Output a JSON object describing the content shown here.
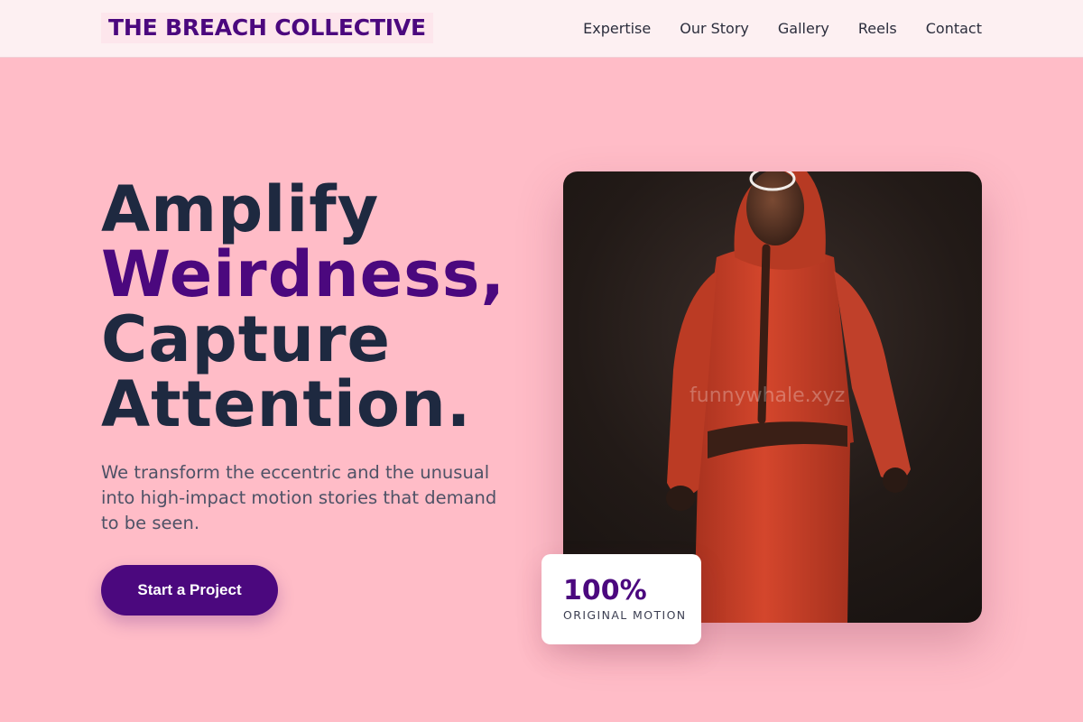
{
  "header": {
    "logo": "THE BREACH COLLECTIVE",
    "nav": [
      "Expertise",
      "Our Story",
      "Gallery",
      "Reels",
      "Contact"
    ]
  },
  "hero": {
    "title_line1": "Amplify",
    "title_accent": "Weirdness,",
    "title_line3": "Capture",
    "title_line4": "Attention.",
    "subtitle": "We transform the eccentric and the unusual into high-impact motion stories that demand to be seen.",
    "cta_label": "Start a Project"
  },
  "image": {
    "watermark": "funnywhale.xyz",
    "subject": "red-jumpsuit-figure"
  },
  "stat": {
    "value": "100%",
    "label": "ORIGINAL MOTION"
  },
  "colors": {
    "background": "#ffbcc7",
    "accent": "#4b087e",
    "heading": "#1e2940"
  }
}
